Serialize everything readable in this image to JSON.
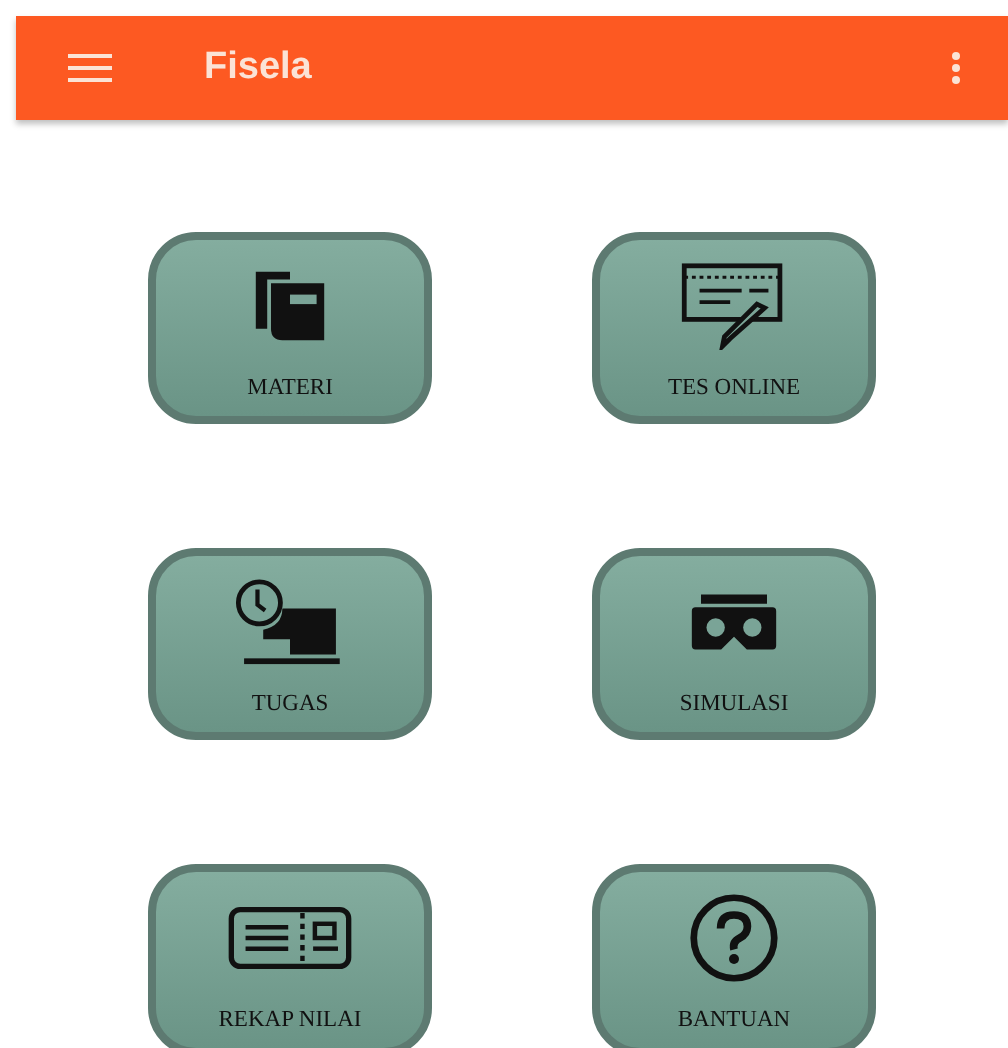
{
  "app_bar": {
    "title": "Fisela"
  },
  "menu_tiles": [
    {
      "label": "MATERI"
    },
    {
      "label": "TES ONLINE"
    },
    {
      "label": "TUGAS"
    },
    {
      "label": "SIMULASI"
    },
    {
      "label": "REKAP NILAI"
    },
    {
      "label": "BANTUAN"
    }
  ]
}
